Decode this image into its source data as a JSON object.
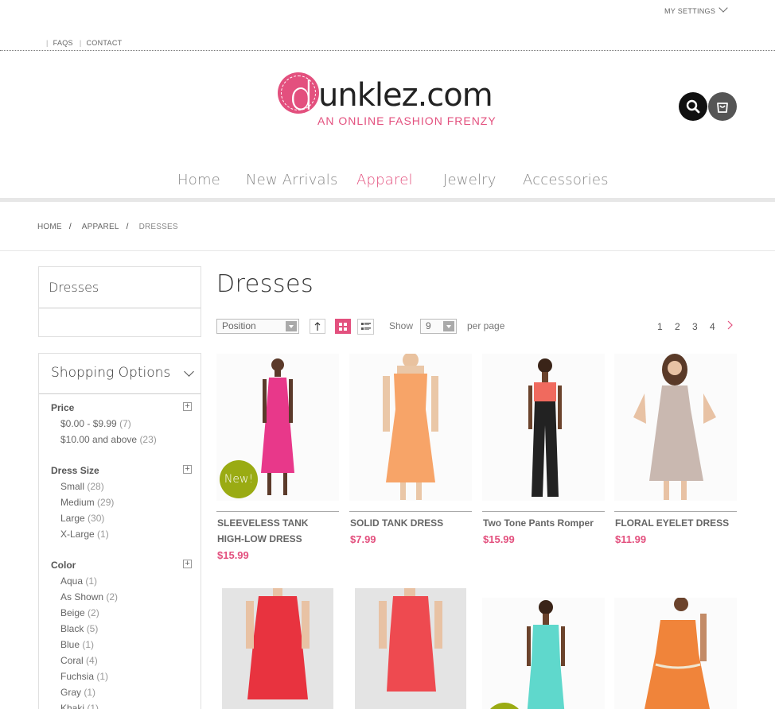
{
  "header": {
    "my_settings": "MY SETTINGS",
    "links": [
      "FAQS",
      "CONTACT"
    ]
  },
  "logo": {
    "first_letter": "d",
    "rest": "unklez.com",
    "tagline": "AN ONLINE FASHION FRENZY"
  },
  "nav": {
    "items": [
      "Home",
      "New Arrivals",
      "Apparel",
      "Jewelry",
      "Accessories"
    ],
    "active": "Apparel"
  },
  "breadcrumb": [
    "HOME",
    "APPAREL",
    "DRESSES"
  ],
  "sidebar": {
    "category_title": "Dresses",
    "options_title": "Shopping Options",
    "filters": [
      {
        "title": "Price",
        "options": [
          {
            "label": "$0.00 - $9.99",
            "count": "(7)"
          },
          {
            "label": "$10.00 and above",
            "count": "(23)"
          }
        ]
      },
      {
        "title": "Dress Size",
        "options": [
          {
            "label": "Small",
            "count": "(28)"
          },
          {
            "label": "Medium",
            "count": "(29)"
          },
          {
            "label": "Large",
            "count": "(30)"
          },
          {
            "label": "X-Large",
            "count": "(1)"
          }
        ]
      },
      {
        "title": "Color",
        "options": [
          {
            "label": "Aqua",
            "count": "(1)"
          },
          {
            "label": "As Shown",
            "count": "(2)"
          },
          {
            "label": "Beige",
            "count": "(2)"
          },
          {
            "label": "Black",
            "count": "(5)"
          },
          {
            "label": "Blue",
            "count": "(1)"
          },
          {
            "label": "Coral",
            "count": "(4)"
          },
          {
            "label": "Fuchsia",
            "count": "(1)"
          },
          {
            "label": "Gray",
            "count": "(1)"
          },
          {
            "label": "Khaki",
            "count": "(1)"
          }
        ]
      }
    ]
  },
  "main": {
    "title": "Dresses",
    "sort_by": "Position",
    "show_label": "Show",
    "per_page_value": "9",
    "per_page_label": "per page",
    "pages": [
      "1",
      "2",
      "3",
      "4"
    ]
  },
  "products": [
    {
      "name": "SLEEVELESS TANK HIGH-LOW DRESS",
      "price": "$15.99",
      "badge": "New!",
      "dress_color": "#e8388a"
    },
    {
      "name": "SOLID TANK DRESS",
      "price": "$7.99",
      "dress_color": "#f7a468"
    },
    {
      "name": "Two Tone Pants Romper",
      "price": "$15.99",
      "dress_color": "#222222"
    },
    {
      "name": "FLORAL EYELET DRESS",
      "price": "$11.99",
      "dress_color": "#c9b8b0"
    },
    {
      "dress_color": "#e8333f"
    },
    {
      "dress_color": "#ee4a50"
    },
    {
      "dress_color": "#5fd8cc"
    },
    {
      "dress_color": "#f0843a"
    }
  ],
  "colors": {
    "accent": "#e3507e",
    "badge": "#9aab13"
  }
}
